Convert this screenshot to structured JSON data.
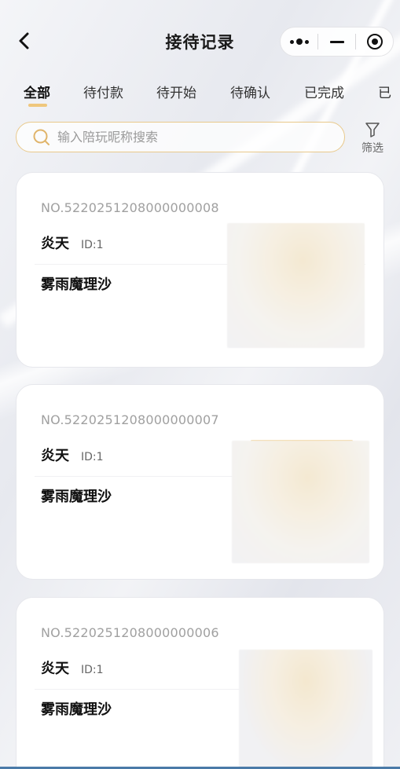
{
  "nav": {
    "title": "接待记录"
  },
  "tabs": [
    {
      "label": "全部",
      "active": true
    },
    {
      "label": "待付款",
      "active": false
    },
    {
      "label": "待开始",
      "active": false
    },
    {
      "label": "待确认",
      "active": false
    },
    {
      "label": "已完成",
      "active": false
    },
    {
      "label": "已",
      "active": false
    }
  ],
  "search": {
    "placeholder": "输入陪玩昵称搜索",
    "value": ""
  },
  "filter": {
    "label": "筛选"
  },
  "orders": [
    {
      "order_no": "NO.5220251208000000008",
      "name": "炎天",
      "id": "ID:1",
      "game": "雾雨魔理沙"
    },
    {
      "order_no": "NO.5220251208000000007",
      "name": "炎天",
      "id": "ID:1",
      "game": "雾雨魔理沙"
    },
    {
      "order_no": "NO.5220251208000000006",
      "name": "炎天",
      "id": "ID:1",
      "game": "雾雨魔理沙"
    }
  ],
  "colors": {
    "accent": "#efc77d",
    "search_border": "#e9c98b"
  }
}
